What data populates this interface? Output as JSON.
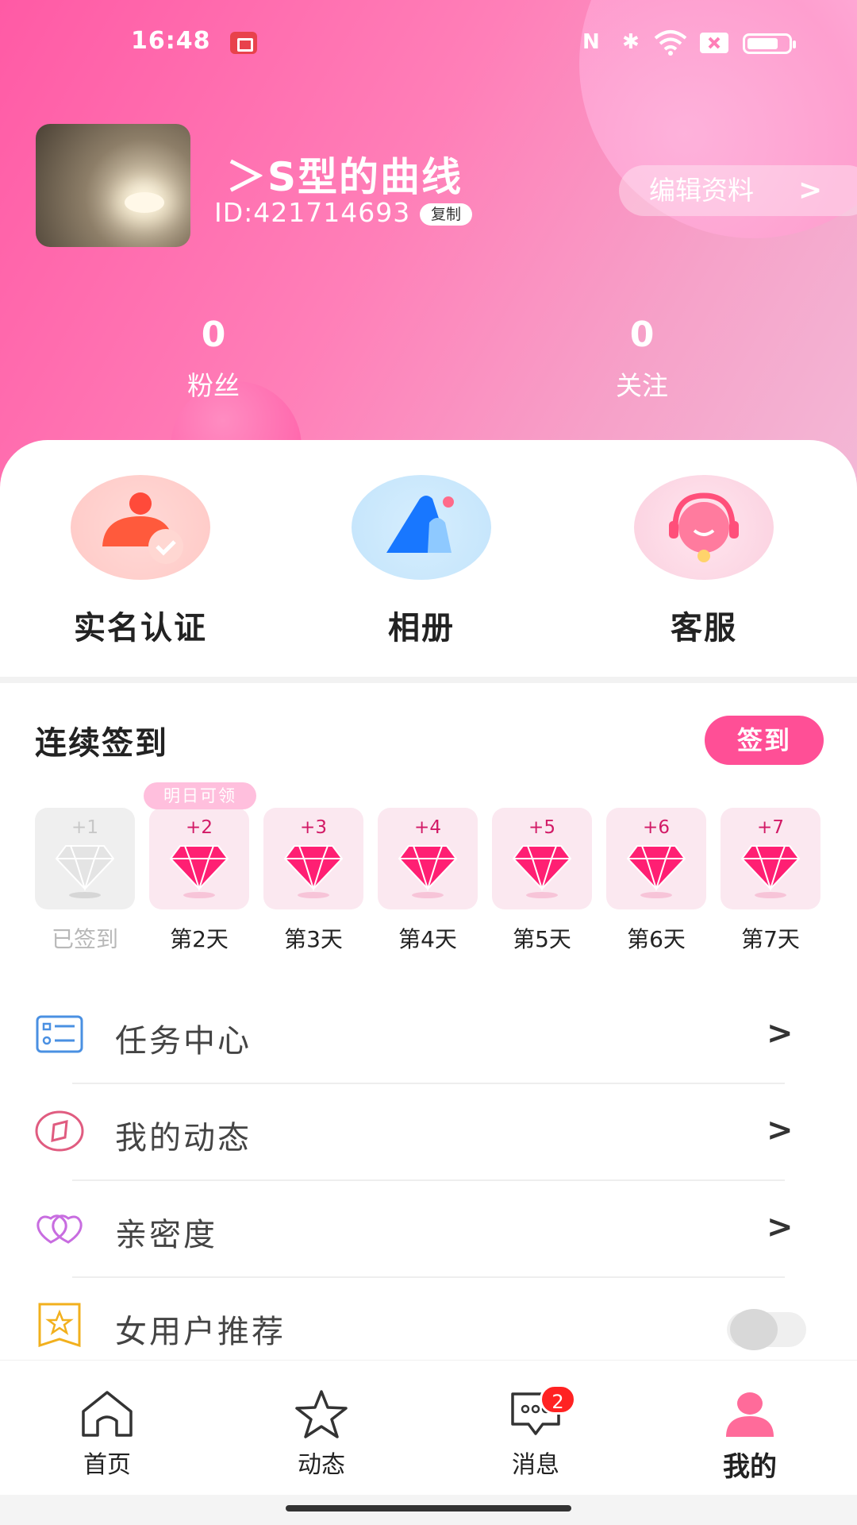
{
  "status_bar": {
    "time": "16:48",
    "nfc": "N",
    "bluetooth": "✱"
  },
  "profile": {
    "nickname": "＞S型的曲线",
    "user_id": "ID:421714693",
    "copy_label": "复制",
    "edit_label": "编辑资料",
    "edit_chevron": ">"
  },
  "stats": [
    {
      "value": "0",
      "label": "粉丝"
    },
    {
      "value": "0",
      "label": "关注"
    }
  ],
  "quick_actions": [
    {
      "label": "实名认证",
      "icon": "verified-user-icon"
    },
    {
      "label": "相册",
      "icon": "album-icon"
    },
    {
      "label": "客服",
      "icon": "customer-service-icon"
    }
  ],
  "checkin": {
    "title": "连续签到",
    "button_label": "签到",
    "tomorrow_badge": "明日可领",
    "days": [
      {
        "points": "+1",
        "label": "已签到",
        "done": true
      },
      {
        "points": "+2",
        "label": "第2天",
        "done": false
      },
      {
        "points": "+3",
        "label": "第3天",
        "done": false
      },
      {
        "points": "+4",
        "label": "第4天",
        "done": false
      },
      {
        "points": "+5",
        "label": "第5天",
        "done": false
      },
      {
        "points": "+6",
        "label": "第6天",
        "done": false
      },
      {
        "points": "+7",
        "label": "第7天",
        "done": false
      }
    ]
  },
  "menu": [
    {
      "label": "任务中心",
      "icon": "task-list-icon",
      "chevron": ">"
    },
    {
      "label": "我的动态",
      "icon": "compass-icon",
      "chevron": ">"
    },
    {
      "label": "亲密度",
      "icon": "intimacy-hearts-icon",
      "chevron": ">"
    },
    {
      "label": "女用户推荐",
      "icon": "star-flag-icon",
      "toggle": false
    }
  ],
  "bottom_nav": [
    {
      "label": "首页",
      "icon": "home-icon"
    },
    {
      "label": "动态",
      "icon": "star-icon"
    },
    {
      "label": "消息",
      "icon": "chat-icon",
      "badge": "2"
    },
    {
      "label": "我的",
      "icon": "profile-icon",
      "active": true
    }
  ],
  "colors": {
    "primary_pink": "#ff4f96",
    "gem_pink": "#ff1f73",
    "header_gradient_start": "#ff5aa5",
    "header_gradient_end": "#f3b8d6"
  }
}
